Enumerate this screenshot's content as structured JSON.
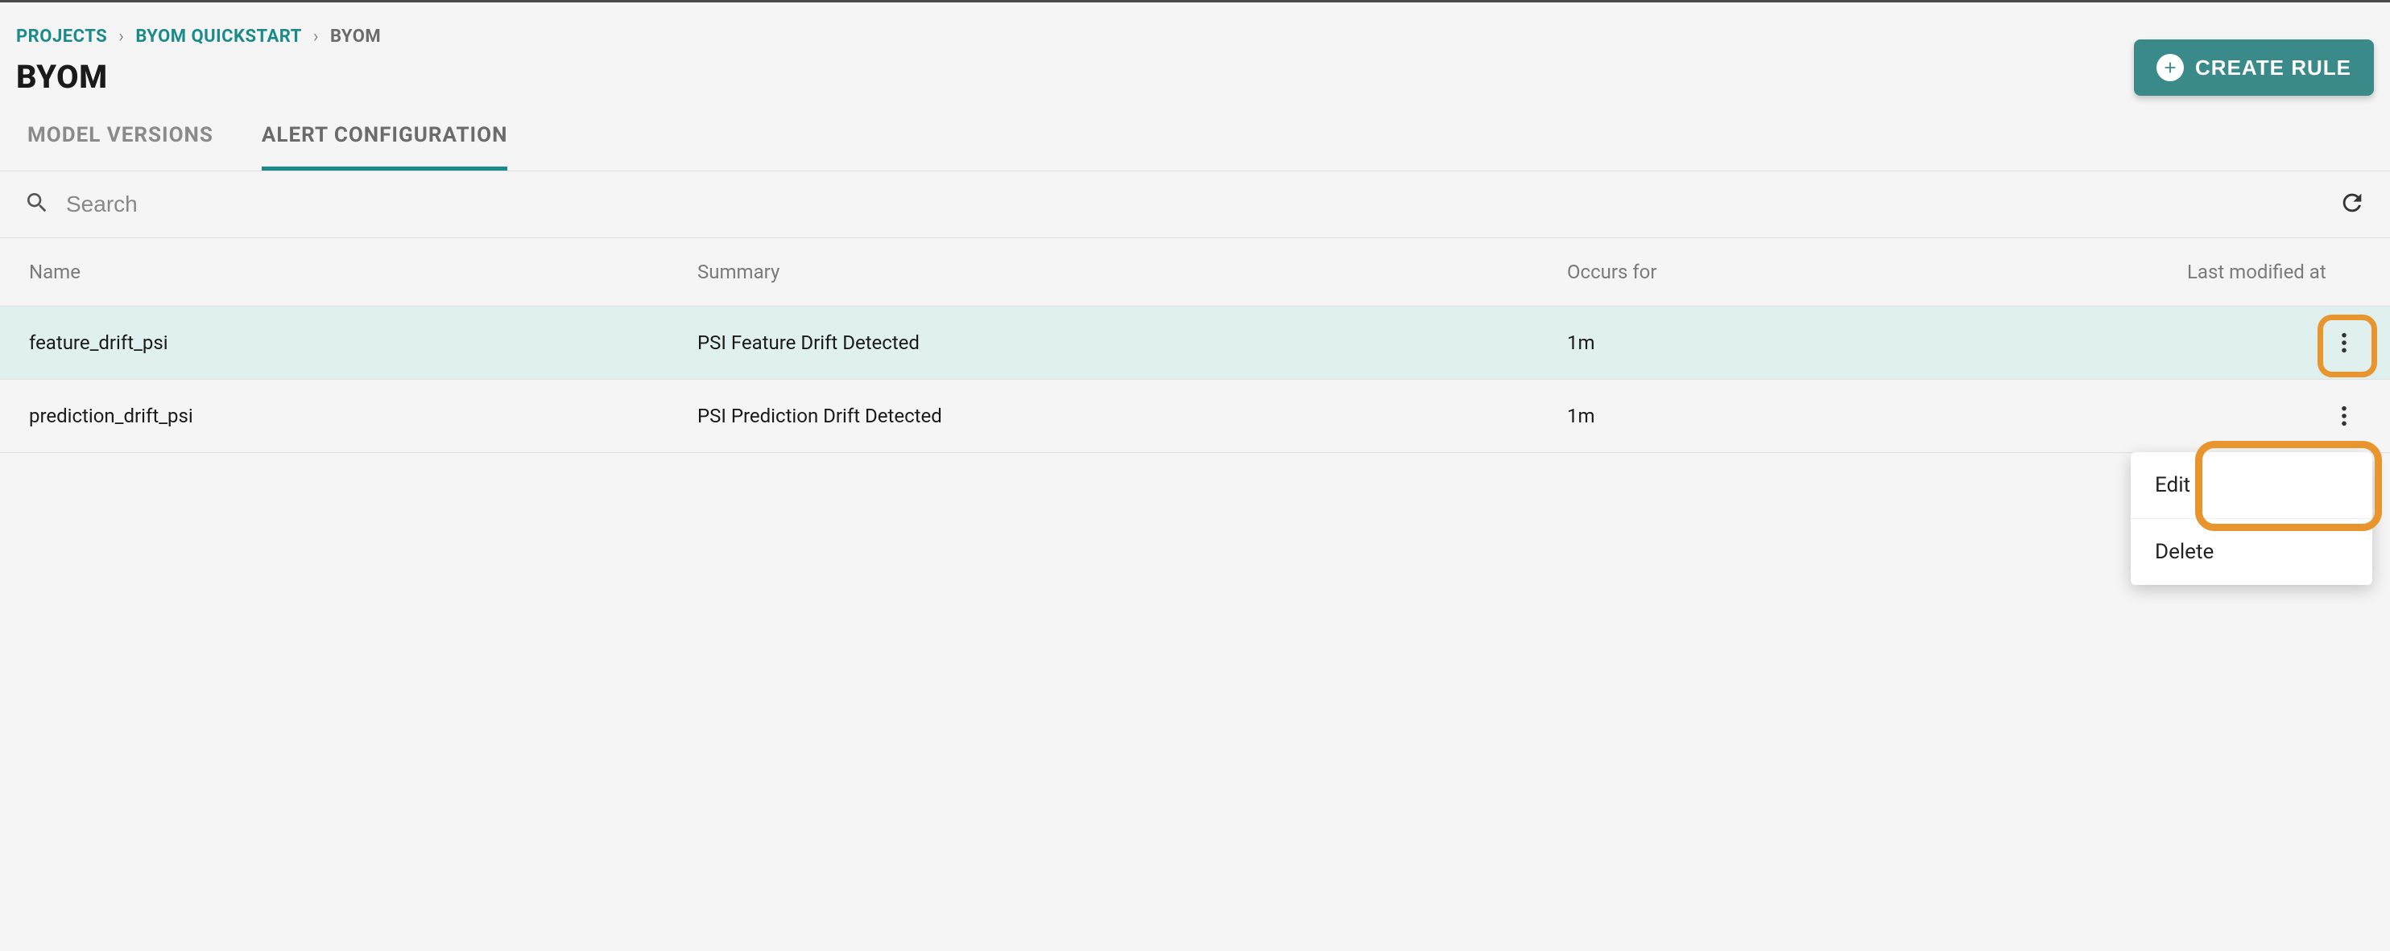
{
  "breadcrumb": {
    "projects": "PROJECTS",
    "quickstart": "BYOM QUICKSTART",
    "current": "BYOM"
  },
  "page_title": "BYOM",
  "create_button": "CREATE RULE",
  "tabs": {
    "model_versions": "MODEL VERSIONS",
    "alert_config": "ALERT CONFIGURATION"
  },
  "search": {
    "placeholder": "Search"
  },
  "columns": {
    "name": "Name",
    "summary": "Summary",
    "occurs": "Occurs for",
    "modified": "Last modified at"
  },
  "rows": [
    {
      "name": "feature_drift_psi",
      "summary": "PSI Feature Drift Detected",
      "occurs": "1m",
      "modified": ""
    },
    {
      "name": "prediction_drift_psi",
      "summary": "PSI Prediction Drift Detected",
      "occurs": "1m",
      "modified": ""
    }
  ],
  "menu": {
    "edit": "Edit",
    "delete": "Delete"
  }
}
